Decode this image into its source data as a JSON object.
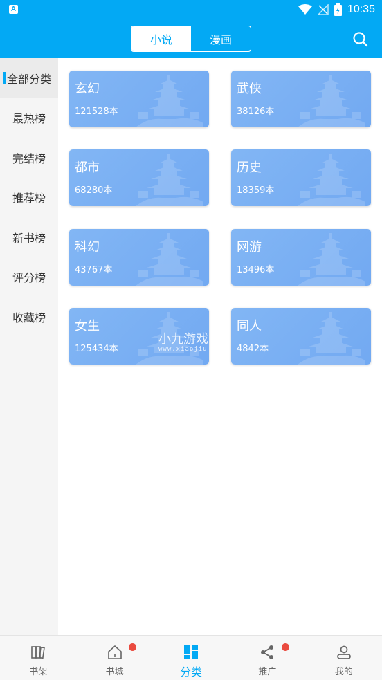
{
  "statusbar": {
    "time": "10:35",
    "app_icon": "A"
  },
  "header": {
    "tabs": [
      {
        "label": "小说",
        "active": true
      },
      {
        "label": "漫画",
        "active": false
      }
    ],
    "search_icon": "search-icon"
  },
  "sidebar": {
    "items": [
      {
        "label": "全部分类",
        "active": true
      },
      {
        "label": "最热榜",
        "active": false
      },
      {
        "label": "完结榜",
        "active": false
      },
      {
        "label": "推荐榜",
        "active": false
      },
      {
        "label": "新书榜",
        "active": false
      },
      {
        "label": "评分榜",
        "active": false
      },
      {
        "label": "收藏榜",
        "active": false
      }
    ]
  },
  "categories": [
    {
      "name": "玄幻",
      "count": "121528本"
    },
    {
      "name": "武侠",
      "count": "38126本"
    },
    {
      "name": "都市",
      "count": "68280本"
    },
    {
      "name": "历史",
      "count": "18359本"
    },
    {
      "name": "科幻",
      "count": "43767本"
    },
    {
      "name": "网游",
      "count": "13496本"
    },
    {
      "name": "女生",
      "count": "125434本"
    },
    {
      "name": "同人",
      "count": "4842本"
    }
  ],
  "watermark": {
    "text": "小九游戏",
    "sub": "www.xiaojiu"
  },
  "bottomnav": {
    "items": [
      {
        "label": "书架",
        "icon": "bookshelf-icon",
        "badge": false
      },
      {
        "label": "书城",
        "icon": "home-icon",
        "badge": true
      },
      {
        "label": "分类",
        "icon": "category-grid-icon",
        "badge": false,
        "active": true
      },
      {
        "label": "推广",
        "icon": "share-icon",
        "badge": true
      },
      {
        "label": "我的",
        "icon": "user-icon",
        "badge": false
      }
    ]
  },
  "colors": {
    "accent": "#03a9f4",
    "card": "#7aafef",
    "badge": "#ea4b3f"
  }
}
